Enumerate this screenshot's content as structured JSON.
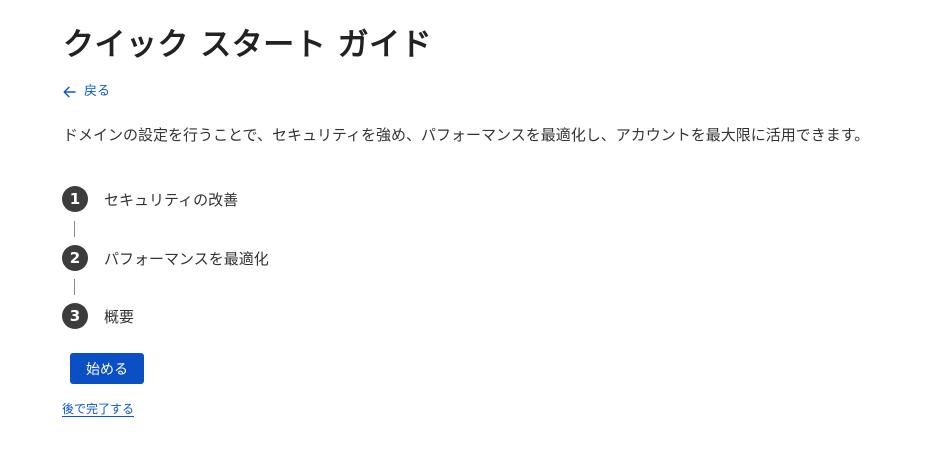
{
  "page": {
    "title": "クイック スタート ガイド",
    "back_label": "戻る",
    "description": "ドメインの設定を行うことで、セキュリティを強め、パフォーマンスを最適化し、アカウントを最大限に活用できます。"
  },
  "steps": [
    {
      "number": "1",
      "label": "セキュリティの改善"
    },
    {
      "number": "2",
      "label": "パフォーマンスを最適化"
    },
    {
      "number": "3",
      "label": "概要"
    }
  ],
  "actions": {
    "start_label": "始める",
    "later_label": "後で完了する"
  },
  "colors": {
    "link": "#0b57d0",
    "primary_button": "#0b4fc4",
    "step_circle": "#3c3c3c"
  },
  "icons": {
    "back": "arrow-left-icon"
  }
}
